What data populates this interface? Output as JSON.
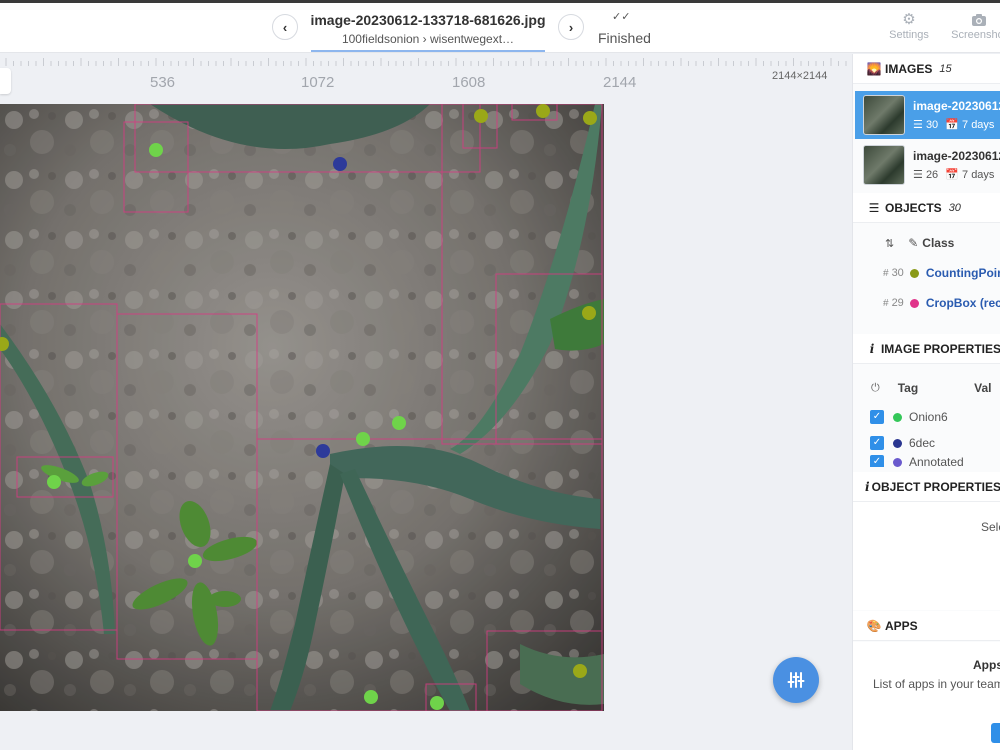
{
  "header": {
    "title": "image-20230612-133718-681626.jpg",
    "breadcrumb": "100fieldsonion › wisentwegext…",
    "status": "Finished",
    "tools": [
      {
        "label": "Settings",
        "icon": "gear-icon"
      },
      {
        "label": "Screenshot",
        "icon": "camera-icon"
      }
    ]
  },
  "canvas": {
    "ruler_labels": [
      "536",
      "1072",
      "1608",
      "2144"
    ],
    "image_size": "2144×2144"
  },
  "sidebar": {
    "images": {
      "title": "IMAGES",
      "count": "15",
      "items": [
        {
          "name": "image-20230612",
          "objects": "30",
          "age": "7 days"
        },
        {
          "name": "image-20230612",
          "objects": "26",
          "age": "7 days"
        }
      ]
    },
    "objects": {
      "title": "OBJECTS",
      "count": "30",
      "sort_label": "Class",
      "classes": [
        {
          "number": "30",
          "name": "CountingPoint",
          "color": "#8a9a18"
        },
        {
          "number": "29",
          "name": "CropBox (rect",
          "color": "#e0338a"
        }
      ]
    },
    "image_properties": {
      "title": "IMAGE PROPERTIES",
      "col_tag": "Tag",
      "col_value": "Val",
      "tags": [
        {
          "name": "Onion6",
          "color": "#34c759"
        },
        {
          "name": "6dec",
          "color": "#2a3690"
        },
        {
          "name": "Annotated",
          "color": "#6a5acd"
        }
      ]
    },
    "object_properties": {
      "title": "OBJECT PROPERTIES",
      "empty_text": "Sele"
    },
    "apps": {
      "title": "APPS",
      "heading": "Apps",
      "text": "List of apps in your team"
    }
  }
}
